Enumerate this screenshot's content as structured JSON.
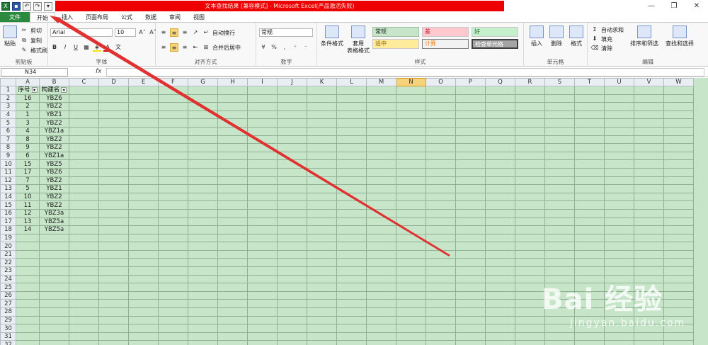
{
  "window": {
    "title": "文本查找结果 [兼容模式] - Microsoft Excel(产品激活失败)",
    "controls": [
      "—",
      "❐",
      "✕"
    ]
  },
  "qat": {
    "icons": [
      "excel-icon",
      "save-icon",
      "undo-icon",
      "redo-icon",
      "customize-icon"
    ]
  },
  "tabs": [
    "文件",
    "开始",
    "插入",
    "页面布局",
    "公式",
    "数据",
    "审阅",
    "视图"
  ],
  "ribbon": {
    "clipboard": {
      "paste": "粘贴",
      "cut": "剪切",
      "copy": "复制",
      "painter": "格式刷",
      "label": "剪贴板"
    },
    "font": {
      "name": "Arial",
      "size": "10",
      "bold": "B",
      "italic": "I",
      "underline": "U",
      "grow": "A˄",
      "shrink": "A˅",
      "label": "字体"
    },
    "align": {
      "wrap": "自动换行",
      "merge": "合并后居中",
      "label": "对齐方式"
    },
    "number": {
      "format": "常规",
      "percent": "%",
      "comma": ",",
      "label": "数字"
    },
    "styles": {
      "cond": "条件格式",
      "table_line1": "套用",
      "table_line2": "表格格式",
      "normal": "常规",
      "bad": "差",
      "good": "好",
      "neutral": "适中",
      "calc": "计算",
      "check": "检查单元格",
      "label": "样式"
    },
    "cells": {
      "insert": "插入",
      "delete": "删除",
      "format": "格式",
      "label": "单元格"
    },
    "editing": {
      "autosum": "自动求和",
      "fill": "填充",
      "clear": "清除",
      "sort": "排序和筛选",
      "find": "查找和选择",
      "label": "编辑"
    }
  },
  "formula": {
    "namebox": "N34",
    "fx": "fx",
    "content": ""
  },
  "columns": [
    "A",
    "B",
    "C",
    "D",
    "E",
    "F",
    "G",
    "H",
    "I",
    "J",
    "K",
    "L",
    "M",
    "N",
    "O",
    "P",
    "Q",
    "R",
    "S",
    "T",
    "U",
    "V",
    "W"
  ],
  "selected_column": "N",
  "headers": [
    "序号",
    "构建名"
  ],
  "rows": [
    [
      "16",
      "YBZ6"
    ],
    [
      "2",
      "YBZ2"
    ],
    [
      "1",
      "YBZ1"
    ],
    [
      "3",
      "YBZ2"
    ],
    [
      "4",
      "YBZ1a"
    ],
    [
      "8",
      "YBZ2"
    ],
    [
      "9",
      "YBZ2"
    ],
    [
      "6",
      "YBZ1a"
    ],
    [
      "15",
      "YBZ5"
    ],
    [
      "17",
      "YBZ6"
    ],
    [
      "7",
      "YBZ2"
    ],
    [
      "5",
      "YBZ1"
    ],
    [
      "10",
      "YBZ2"
    ],
    [
      "11",
      "YBZ2"
    ],
    [
      "12",
      "YBZ3a"
    ],
    [
      "13",
      "YBZ5a"
    ],
    [
      "14",
      "YBZ5a"
    ]
  ],
  "row_count": 32,
  "colors": {
    "sheet_bg": "#c7e6c9",
    "arrow": "#e03030",
    "title_red": "#ee0000"
  },
  "watermark": {
    "brand": "Bai  经验",
    "url": "jingyan.baidu.com"
  }
}
